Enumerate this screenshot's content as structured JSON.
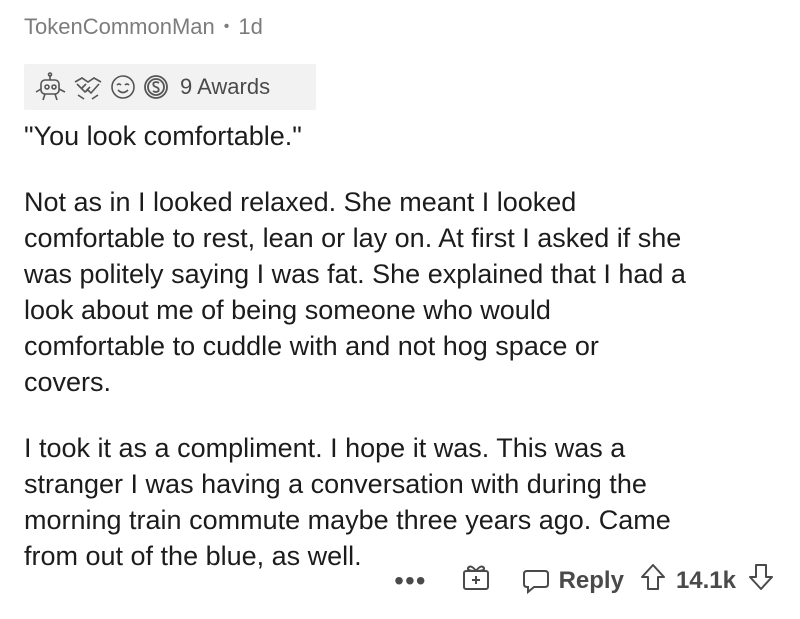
{
  "comment": {
    "author": "TokenCommonMan",
    "separator": "•",
    "age": "1d",
    "awards": {
      "count_label": "9 Awards",
      "icons": [
        "robot-award-icon",
        "handshake-award-icon",
        "wholesome-award-icon",
        "silver-coin-award-icon"
      ]
    },
    "paragraphs": [
      {
        "lines": [
          "\"You look comfortable.\""
        ]
      },
      {
        "lines": [
          "Not as in I looked relaxed.  She meant I looked",
          "comfortable to rest, lean or lay on. At first I asked if she",
          "was politely saying I was fat.  She explained that I had a",
          "look about me of being someone who would",
          "comfortable to cuddle with and not hog space or",
          "covers."
        ]
      },
      {
        "lines": [
          "I took it as a compliment.  I hope it was.  This was a",
          "stranger I was having a conversation with during the",
          "morning train commute maybe three years ago.  Came",
          "from out of the blue, as well."
        ]
      }
    ],
    "actions": {
      "more_label": "•••",
      "reply_label": "Reply",
      "score": "14.1k"
    }
  },
  "colors": {
    "meta_gray": "#7c7c7c",
    "text": "#1c1c1c",
    "award_bg": "#f2f2f2"
  }
}
